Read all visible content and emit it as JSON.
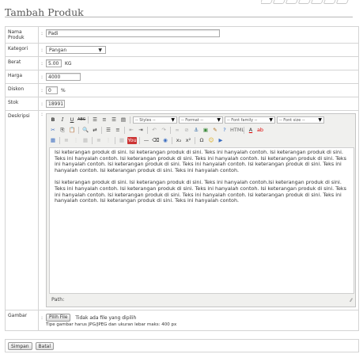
{
  "page": {
    "title": "Tambah Produk"
  },
  "form": {
    "name": {
      "label": "Nama Produk",
      "value": "Padi"
    },
    "category": {
      "label": "Kategori",
      "value": "Pangan"
    },
    "weight": {
      "label": "Berat",
      "value": "5.00",
      "unit": "KG"
    },
    "price": {
      "label": "Harga",
      "value": "4000"
    },
    "discount": {
      "label": "Diskon",
      "value": "0",
      "unit": "%"
    },
    "stock": {
      "label": "Stok",
      "value": "18991"
    },
    "description": {
      "label": "Deskripsi",
      "toolbar": {
        "styles": "-- Styles --",
        "format": "-- Format --",
        "font_family": "-- Font family --",
        "font_size": "-- Font size --"
      },
      "paragraphs": [
        "Isi keterangan produk di sini.  Isi keterangan produk di sini. Teks ini hanyalah contoh. Isi keterangan produk di sini. Teks ini hanyalah contoh. Isi keterangan produk di sini. Teks ini hanyalah contoh. Isi keterangan produk di sini. Teks ini hanyalah contoh. Isi keterangan produk di sini. Teks ini hanyalah contoh. Isi keterangan produk di sini. Teks ini hanyalah contoh. Isi keterangan produk di sini. Teks ini hanyalah contoh.",
        "Isi keterangan produk di sini.  Isi keterangan produk di sini. Teks ini hanyalah contoh.Isi keterangan produk di sini. Teks ini hanyalah contoh. Isi keterangan produk di sini. Teks ini hanyalah contoh. Isi keterangan produk di sini. Teks ini hanyalah contoh. Isi keterangan produk di sini. Teks ini hanyalah contoh. Isi keterangan produk di sini. Teks ini hanyalah contoh. Isi keterangan produk di sini. Teks ini hanyalah contoh."
      ],
      "path_label": "Path:"
    },
    "image": {
      "label": "Gambar",
      "button": "Pilih File",
      "status": "Tidak ada file yang dipilih",
      "hint": "Tipe gambar harus JPG/JPEG dan ukuran lebar maks: 400 px"
    }
  },
  "actions": {
    "save": "Simpan",
    "cancel": "Batal"
  },
  "toolbar_row2_glyphs": {
    "cut": "✂",
    "copy": "⎘",
    "paste": "📋",
    "find": "🔍",
    "replace": "⇄",
    "bullets": "☰",
    "numbers": "≡",
    "outdent": "⇤",
    "indent": "⇥",
    "undo": "↶",
    "redo": "↷",
    "link": "∞",
    "unlink": "⊘",
    "anchor": "⚓",
    "image": "▣",
    "cleanup": "✎",
    "help": "?",
    "html": "HTML",
    "forecolor": "A",
    "backcolor": "ab"
  },
  "toolbar_row3_glyphs": {
    "table": "▦",
    "row": "≣",
    "col": "⋮",
    "rule": "—",
    "remove": "⌫",
    "sub": "x₂",
    "sup": "x²",
    "omega": "Ω",
    "emoticon": "☺",
    "media": "▶",
    "youtube": "You",
    "visual": "◉"
  }
}
